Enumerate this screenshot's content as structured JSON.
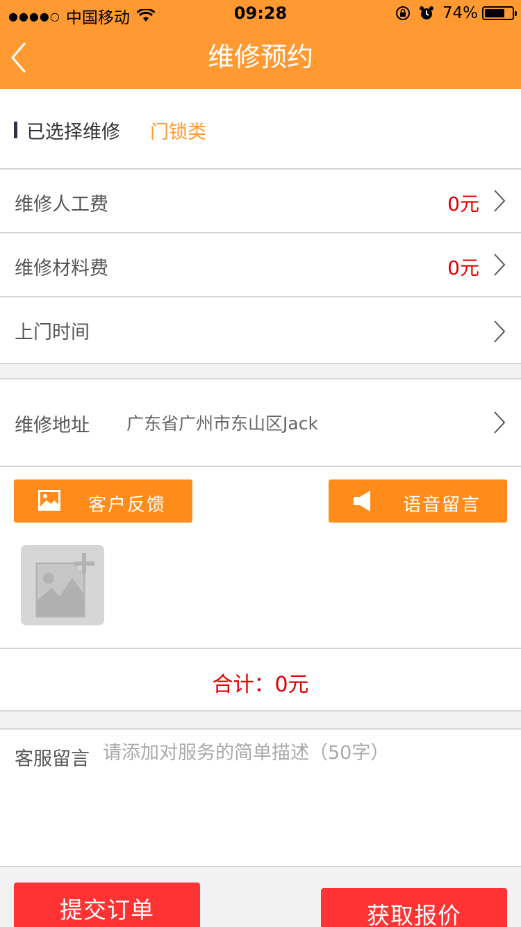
{
  "status_bar": {
    "signal": "●●●●○",
    "carrier": "中国移动",
    "time": "09:28",
    "battery_percent": "74%",
    "battery_level": 0.74
  },
  "nav": {
    "title": "维修预约",
    "back_icon": "chevron-left-icon"
  },
  "selected_repair": {
    "label": "已选择维修",
    "value": "门锁类"
  },
  "rows": [
    {
      "label": "维修人工费",
      "value": "0元"
    },
    {
      "label": "维修材料费",
      "value": "0元"
    },
    {
      "label": "上门时间",
      "value": ""
    }
  ],
  "address": {
    "label": "维修地址",
    "value": "广东省广州市东山区Jack"
  },
  "media": {
    "feedback_label": "客户反馈",
    "voice_label": "语音留言",
    "feedback_icon": "image-icon",
    "voice_icon": "speaker-icon",
    "add_photo_icon": "add-photo-icon"
  },
  "total": {
    "text": "合计：0元"
  },
  "message": {
    "label": "客服留言",
    "placeholder": "请添加对服务的简单描述（50字）",
    "value": ""
  },
  "actions": {
    "submit_label": "提交订单",
    "quote_label": "获取报价"
  },
  "colors": {
    "header": "#ff9a33",
    "accent_orange": "#ff8c1a",
    "price_red": "#e00000",
    "button_red": "#ff3333"
  }
}
